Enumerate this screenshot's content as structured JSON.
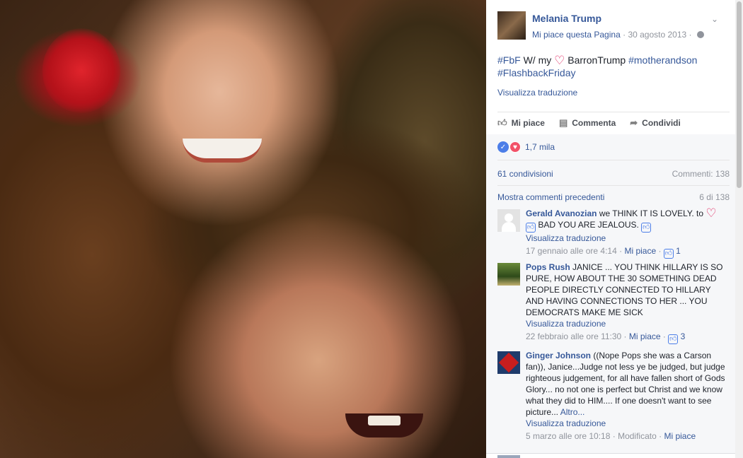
{
  "post": {
    "page_name": "Melania Trump",
    "like_page": "Mi piace questa Pagina",
    "separator": "·",
    "date": "30 agosto 2013",
    "text_part1": "#FbF",
    "text_part2": " W/ my ",
    "heart": "♡",
    "text_part3": " BarronTrump ",
    "hashtag_mother": "#motherandson",
    "hashtag_flashback": "#FlashbackFriday",
    "translate": "Visualizza traduzione"
  },
  "actions": {
    "like": "Mi piace",
    "comment": "Commenta",
    "share": "Condividi"
  },
  "stats": {
    "reactions_count": "1,7 mila",
    "shares": "61 condivisioni",
    "comments": "Commenti: 138",
    "show_previous": "Mostra commenti precedenti",
    "counter": "6 di 138"
  },
  "comments": [
    {
      "author": "Gerald Avanozian",
      "text": " we THINK IT IS LOVELY. to ",
      "text2": " BAD YOU ARE JEALOUS. ",
      "translate": "Visualizza traduzione",
      "time": "17 gennaio alle ore 4:14",
      "like_label": "Mi piace",
      "likes": "1"
    },
    {
      "author": "Pops Rush",
      "text": " JANICE ... YOU THINK HILLARY IS SO PURE, HOW ABOUT THE 30 SOMETHING DEAD PEOPLE DIRECTLY CONNECTED TO HILLARY AND HAVING CONNECTIONS TO HER ... YOU DEMOCRATS MAKE ME SICK",
      "translate": "Visualizza traduzione",
      "time": "22 febbraio alle ore 11:30",
      "like_label": "Mi piace",
      "likes": "3"
    },
    {
      "author": "Ginger Johnson",
      "text": " ((Nope Pops she was a Carson fan)), Janice...Judge not less ye be judged, but judge righteous judgement, for all have fallen short of Gods Glory... no not one is perfect but Christ and we know what they did to HIM.... If one doesn't want to see picture... ",
      "more": "Altro...",
      "translate": "Visualizza traduzione",
      "time": "5 marzo alle ore 10:18",
      "edited": "Modificato",
      "like_label": "Mi piace"
    }
  ],
  "colors": {
    "link": "#365899",
    "text": "#1d2129",
    "meta": "#90949c",
    "like_blue": "#4c7ee8",
    "love_red": "#f25268"
  }
}
